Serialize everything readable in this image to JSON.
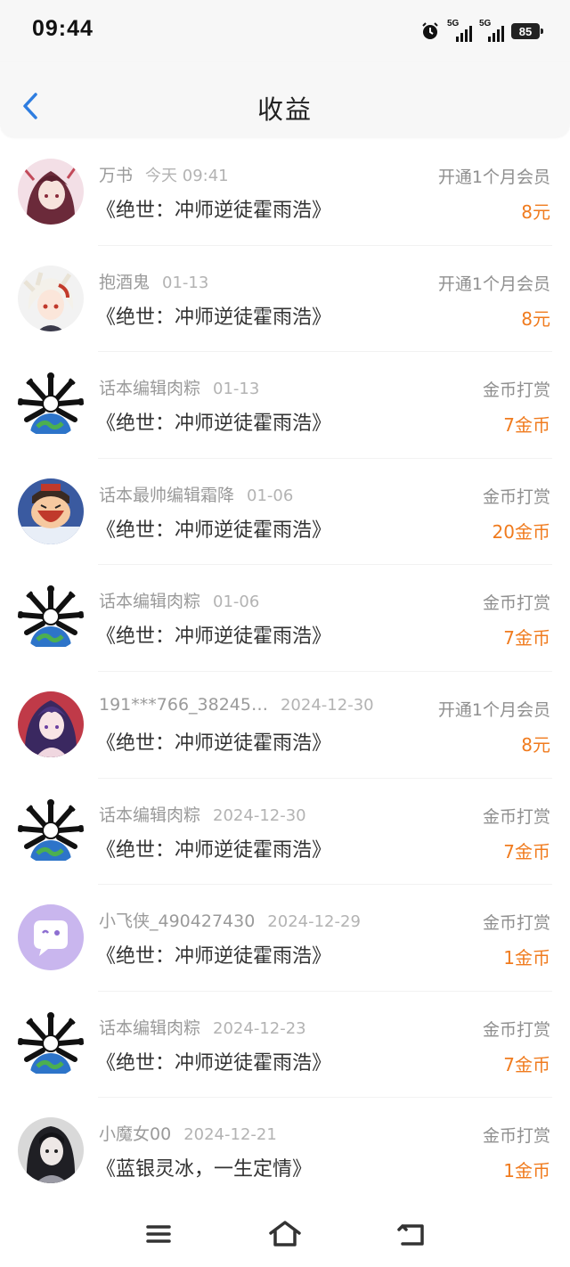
{
  "status_bar": {
    "time": "09:44",
    "network1": "5G",
    "network2": "5G",
    "battery": "85"
  },
  "header": {
    "title": "收益",
    "back_icon": "chevron-left-icon"
  },
  "colors": {
    "accent_blue": "#2e7de0",
    "amount_orange": "#f07b1e",
    "meta_gray": "#9a9a9a"
  },
  "rows": [
    {
      "user": "万书",
      "date": "今天 09:41",
      "book": "《绝世：冲师逆徒霍雨浩》",
      "type": "开通1个月会员",
      "amount": "8元",
      "avatar": "anime-girl-red-avatar"
    },
    {
      "user": "抱酒鬼",
      "date": "01-13",
      "book": "《绝世：冲师逆徒霍雨浩》",
      "type": "开通1个月会员",
      "amount": "8元",
      "avatar": "white-hair-anime-avatar"
    },
    {
      "user": "话本编辑肉粽",
      "date": "01-13",
      "book": "《绝世：冲师逆徒霍雨浩》",
      "type": "金币打赏",
      "amount": "7金币",
      "avatar": "earth-bones-avatar"
    },
    {
      "user": "话本最帅编辑霜降",
      "date": "01-06",
      "book": "《绝世：冲师逆徒霍雨浩》",
      "type": "金币打赏",
      "amount": "20金币",
      "avatar": "cartoon-laughing-avatar"
    },
    {
      "user": "话本编辑肉粽",
      "date": "01-06",
      "book": "《绝世：冲师逆徒霍雨浩》",
      "type": "金币打赏",
      "amount": "7金币",
      "avatar": "earth-bones-avatar"
    },
    {
      "user": "191***766_38245…",
      "date": "2024-12-30",
      "book": "《绝世：冲师逆徒霍雨浩》",
      "type": "开通1个月会员",
      "amount": "8元",
      "avatar": "anime-girl-purple-avatar"
    },
    {
      "user": "话本编辑肉粽",
      "date": "2024-12-30",
      "book": "《绝世：冲师逆徒霍雨浩》",
      "type": "金币打赏",
      "amount": "7金币",
      "avatar": "earth-bones-avatar"
    },
    {
      "user": "小飞侠_490427430",
      "date": "2024-12-29",
      "book": "《绝世：冲师逆徒霍雨浩》",
      "type": "金币打赏",
      "amount": "1金币",
      "avatar": "chat-bubble-avatar"
    },
    {
      "user": "话本编辑肉粽",
      "date": "2024-12-23",
      "book": "《绝世：冲师逆徒霍雨浩》",
      "type": "金币打赏",
      "amount": "7金币",
      "avatar": "earth-bones-avatar"
    },
    {
      "user": "小魔女00",
      "date": "2024-12-21",
      "book": "《蓝银灵冰，一生定情》",
      "type": "金币打赏",
      "amount": "1金币",
      "avatar": "dark-hair-girl-avatar"
    }
  ],
  "nav": {
    "menu_icon": "menu-icon",
    "home_icon": "home-icon",
    "back_icon": "back-icon"
  }
}
